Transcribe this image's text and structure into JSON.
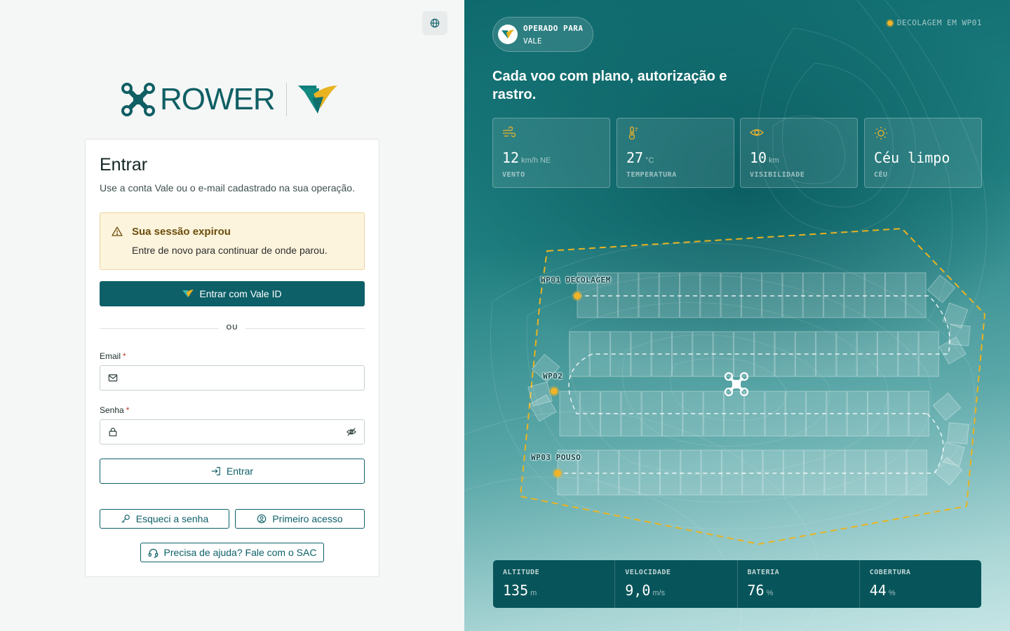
{
  "brand": {
    "name": "ROWER"
  },
  "login": {
    "title": "Entrar",
    "subtitle": "Use a conta Vale ou o e-mail cadastrado na sua operação.",
    "alert": {
      "title": "Sua sessão expirou",
      "text": "Entre de novo para continuar de onde parou."
    },
    "vale_button": "Entrar com Vale ID",
    "divider": "OU",
    "email": {
      "label": "Email",
      "required": "*",
      "value": "",
      "placeholder": ""
    },
    "password": {
      "label": "Senha",
      "required": "*",
      "value": "",
      "placeholder": ""
    },
    "submit": "Entrar",
    "forgot": "Esqueci a senha",
    "first_access": "Primeiro acesso",
    "help": "Precisa de ajuda? Fale com o SAC"
  },
  "hero": {
    "operator": {
      "label": "OPERADO PARA",
      "name": "VALE"
    },
    "status": "DECOLAGEM EM WP01",
    "headline": "Cada voo com plano, autorização e rastro.",
    "weather": [
      {
        "icon": "wind-icon",
        "value": "12",
        "unit": "km/h NE",
        "label": "VENTO"
      },
      {
        "icon": "thermometer-icon",
        "value": "27",
        "unit": "°C",
        "label": "TEMPERATURA"
      },
      {
        "icon": "eye-icon",
        "value": "10",
        "unit": "km",
        "label": "VISIBILIDADE"
      },
      {
        "icon": "sun-icon",
        "value": "Céu limpo",
        "unit": "",
        "label": "CÉU"
      }
    ],
    "waypoints": [
      {
        "id": "WP01",
        "label": "WP01 DECOLAGEM"
      },
      {
        "id": "WP02",
        "label": "WP02"
      },
      {
        "id": "WP03",
        "label": "WP03 POUSO"
      }
    ],
    "telemetry": [
      {
        "label": "ALTITUDE",
        "value": "135",
        "unit": "m"
      },
      {
        "label": "VELOCIDADE",
        "value": "9,0",
        "unit": "m/s"
      },
      {
        "label": "BATERIA",
        "value": "76",
        "unit": "%"
      },
      {
        "label": "COBERTURA",
        "value": "44",
        "unit": "%"
      }
    ]
  },
  "colors": {
    "primary": "#0d6068",
    "accent": "#f0b429",
    "alert_bg": "#fdf4dd",
    "alert_text": "#6b4e0c",
    "telemetry_bg": "#07555a"
  }
}
